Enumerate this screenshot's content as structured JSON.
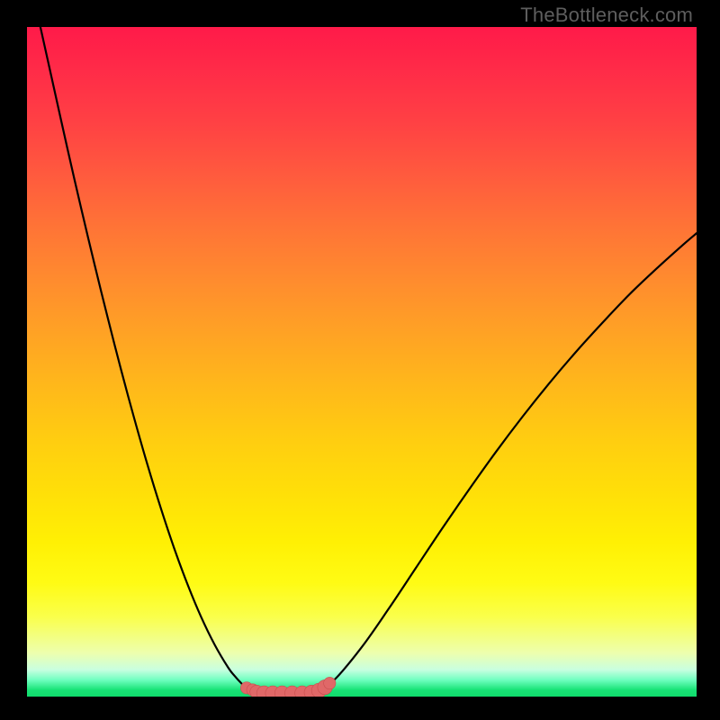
{
  "watermark": {
    "text": "TheBottleneck.com"
  },
  "colors": {
    "page_bg": "#000000",
    "curve": "#000000",
    "marker_fill": "#e06868",
    "marker_stroke": "#c94f4f"
  },
  "chart_data": {
    "type": "line",
    "title": "",
    "xlabel": "",
    "ylabel": "",
    "xlim": [
      0,
      100
    ],
    "ylim": [
      0,
      100
    ],
    "grid": false,
    "series": [
      {
        "name": "left-branch",
        "x": [
          2,
          4,
          6,
          8,
          10,
          12,
          14,
          16,
          18,
          20,
          22,
          24,
          26,
          28,
          30,
          31,
          32,
          32.8,
          33.7
        ],
        "values": [
          100,
          91,
          82,
          73.3,
          64.9,
          56.8,
          49.0,
          41.6,
          34.6,
          28.1,
          22.1,
          16.7,
          11.9,
          7.8,
          4.4,
          3.1,
          2.0,
          1.3,
          1.0
        ]
      },
      {
        "name": "trough",
        "x": [
          33.7,
          36,
          39,
          42,
          43.8
        ],
        "values": [
          1.0,
          0.5,
          0.5,
          0.5,
          1.0
        ]
      },
      {
        "name": "right-branch",
        "x": [
          43.8,
          46,
          50,
          54,
          58,
          62,
          66,
          70,
          74,
          78,
          82,
          86,
          90,
          94,
          98,
          100
        ],
        "values": [
          1.0,
          2.6,
          7.4,
          13.1,
          19.1,
          25.1,
          30.9,
          36.5,
          41.8,
          46.8,
          51.5,
          55.9,
          60.1,
          63.9,
          67.5,
          69.2
        ]
      }
    ],
    "markers": {
      "name": "trough-highlight",
      "points": [
        {
          "x": 32.8,
          "y": 1.3,
          "r": 0.9
        },
        {
          "x": 33.7,
          "y": 1.0,
          "r": 0.9
        },
        {
          "x": 34.3,
          "y": 0.7,
          "r": 1.0
        },
        {
          "x": 35.4,
          "y": 0.5,
          "r": 1.1
        },
        {
          "x": 36.7,
          "y": 0.5,
          "r": 1.1
        },
        {
          "x": 38.1,
          "y": 0.5,
          "r": 1.1
        },
        {
          "x": 39.6,
          "y": 0.5,
          "r": 1.1
        },
        {
          "x": 41.1,
          "y": 0.5,
          "r": 1.1
        },
        {
          "x": 42.5,
          "y": 0.6,
          "r": 1.1
        },
        {
          "x": 43.6,
          "y": 0.9,
          "r": 1.1
        },
        {
          "x": 44.5,
          "y": 1.4,
          "r": 1.1
        },
        {
          "x": 45.2,
          "y": 2.0,
          "r": 0.9
        }
      ]
    }
  }
}
